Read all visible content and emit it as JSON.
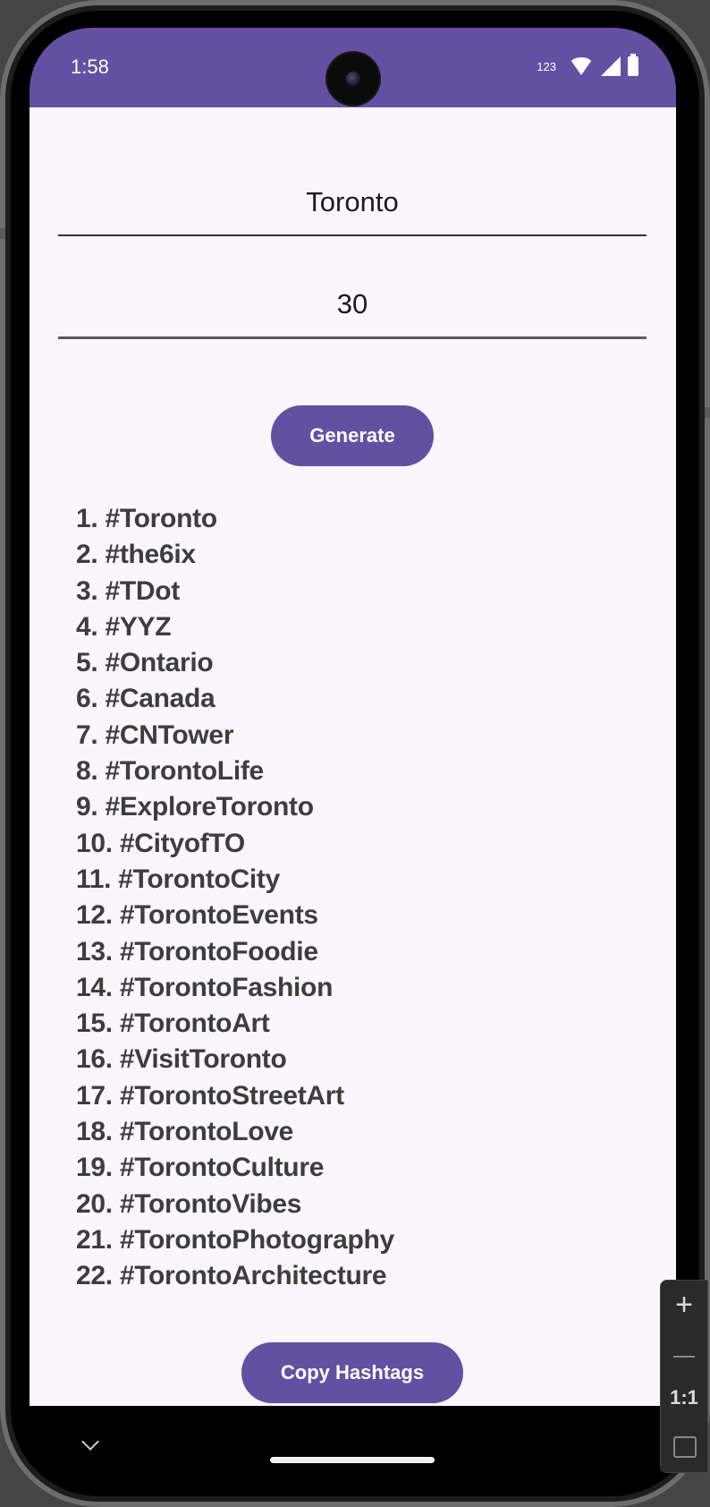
{
  "status_bar": {
    "time": "1:58",
    "network_label": "123",
    "color": "#6350a2"
  },
  "form": {
    "topic_value": "Toronto",
    "count_value": "30",
    "generate_label": "Generate"
  },
  "hashtags": [
    "1. #Toronto",
    "2. #the6ix",
    "3. #TDot",
    "4. #YYZ",
    "5. #Ontario",
    "6. #Canada",
    "7. #CNTower",
    "8. #TorontoLife",
    "9. #ExploreToronto",
    "10. #CityofTO",
    "11. #TorontoCity",
    "12. #TorontoEvents",
    "13. #TorontoFoodie",
    "14. #TorontoFashion",
    "15. #TorontoArt",
    "16. #VisitToronto",
    "17. #TorontoStreetArt",
    "18. #TorontoLove",
    "19. #TorontoCulture",
    "20. #TorontoVibes",
    "21. #TorontoPhotography",
    "22. #TorontoArchitecture"
  ],
  "copy_label": "Copy Hashtags",
  "zoom_controls": {
    "plus": "+",
    "reset": "1:1"
  },
  "colors": {
    "accent": "#6350a2",
    "background": "#fbf6fd",
    "text": "#3d3d3d"
  }
}
